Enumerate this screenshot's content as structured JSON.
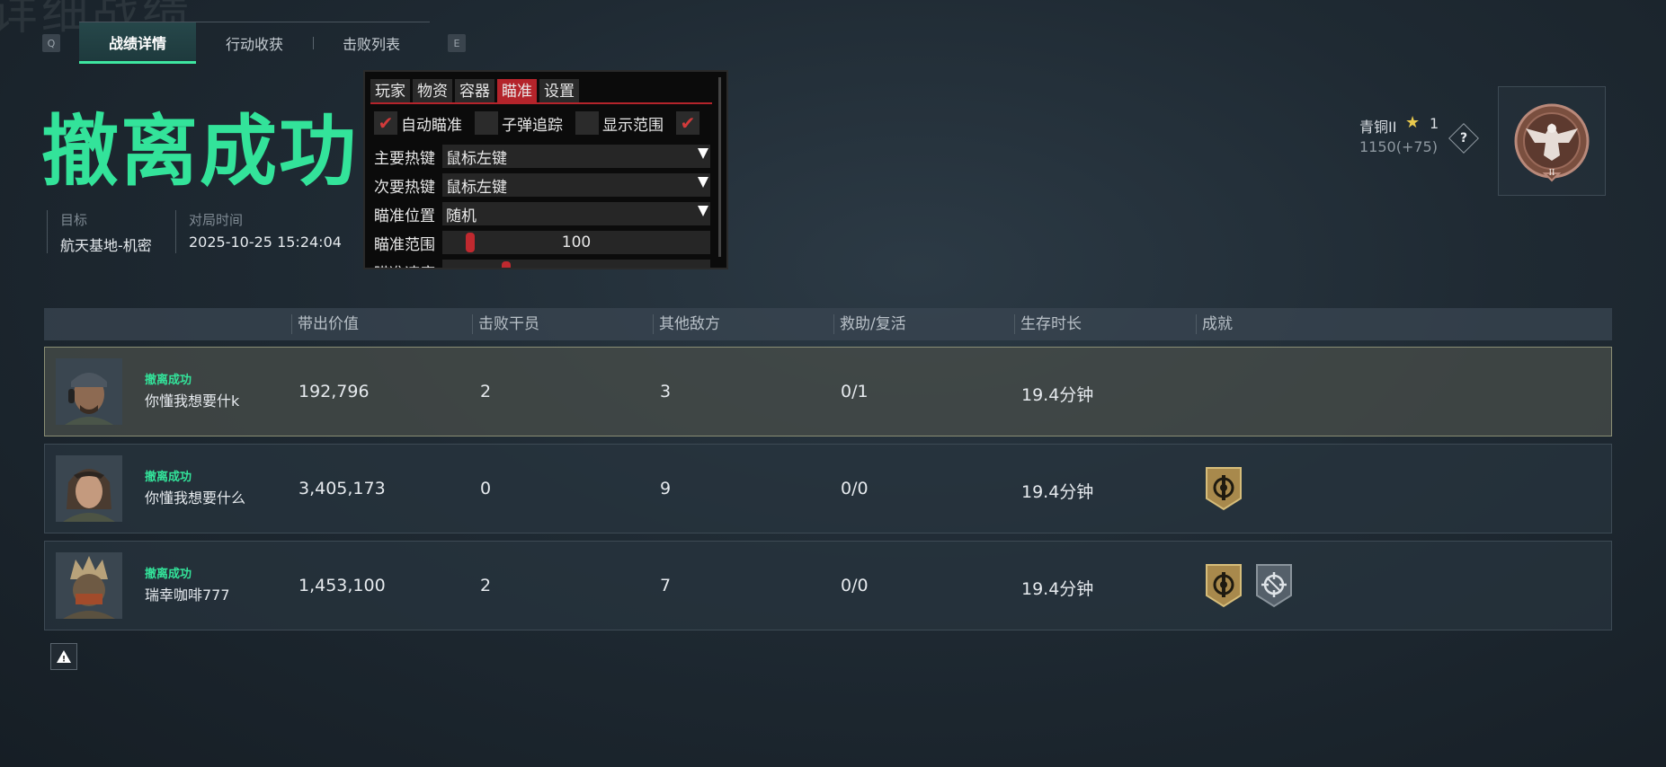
{
  "bg_title": "详细战绩",
  "hotkeys": {
    "prev": "Q",
    "next": "E"
  },
  "tabs": [
    {
      "label": "战绩详情",
      "active": true
    },
    {
      "label": "行动收获",
      "active": false
    },
    {
      "label": "击败列表",
      "active": false
    }
  ],
  "result_title": "撤离成功",
  "meta": {
    "target_label": "目标",
    "target_value": "航天基地-机密",
    "time_label": "对局时间",
    "time_value": "2025-10-25 15:24:04"
  },
  "overlay": {
    "tabs": [
      "玩家",
      "物资",
      "容器",
      "瞄准",
      "设置"
    ],
    "active_tab": "瞄准",
    "checks": [
      {
        "label": "自动瞄准",
        "checked": true
      },
      {
        "label": "子弹追踪",
        "checked": false
      },
      {
        "label": "显示范围",
        "checked": false
      },
      {
        "label": "",
        "checked": true
      }
    ],
    "rows": [
      {
        "label": "主要热键",
        "value": "鼠标左键"
      },
      {
        "label": "次要热键",
        "value": "鼠标左键"
      },
      {
        "label": "瞄准位置",
        "value": "随机"
      }
    ],
    "range_label": "瞄准范围",
    "range_value": "100",
    "cut_label": "瞄准速度"
  },
  "rank": {
    "name": "青铜II",
    "stars": "1",
    "points": "1150(+75)",
    "help": "?",
    "emblem_numeral": "II"
  },
  "table": {
    "headers": [
      "带出价值",
      "击败干员",
      "其他敌方",
      "救助/复活",
      "生存时长",
      "成就"
    ],
    "rows": [
      {
        "status": "撤离成功",
        "name": "你懂我想要什k",
        "value": "192,796",
        "kills": "2",
        "others": "3",
        "assist": "0/1",
        "time": "19.4分钟",
        "badges": [],
        "highlight": true
      },
      {
        "status": "撤离成功",
        "name": "你懂我想要什么",
        "value": "3,405,173",
        "kills": "0",
        "others": "9",
        "assist": "0/0",
        "time": "19.4分钟",
        "badges": [
          "gold-badge-icon"
        ],
        "highlight": false
      },
      {
        "status": "撤离成功",
        "name": "瑞幸咖啡777",
        "value": "1,453,100",
        "kills": "2",
        "others": "7",
        "assist": "0/0",
        "time": "19.4分钟",
        "badges": [
          "gold-badge-icon",
          "grey-crosshair-badge-icon"
        ],
        "highlight": false
      }
    ]
  },
  "warning_icon": "!",
  "colors": {
    "accent": "#33e39a",
    "overlay_accent": "#b4242b",
    "star": "#e9c94d"
  }
}
